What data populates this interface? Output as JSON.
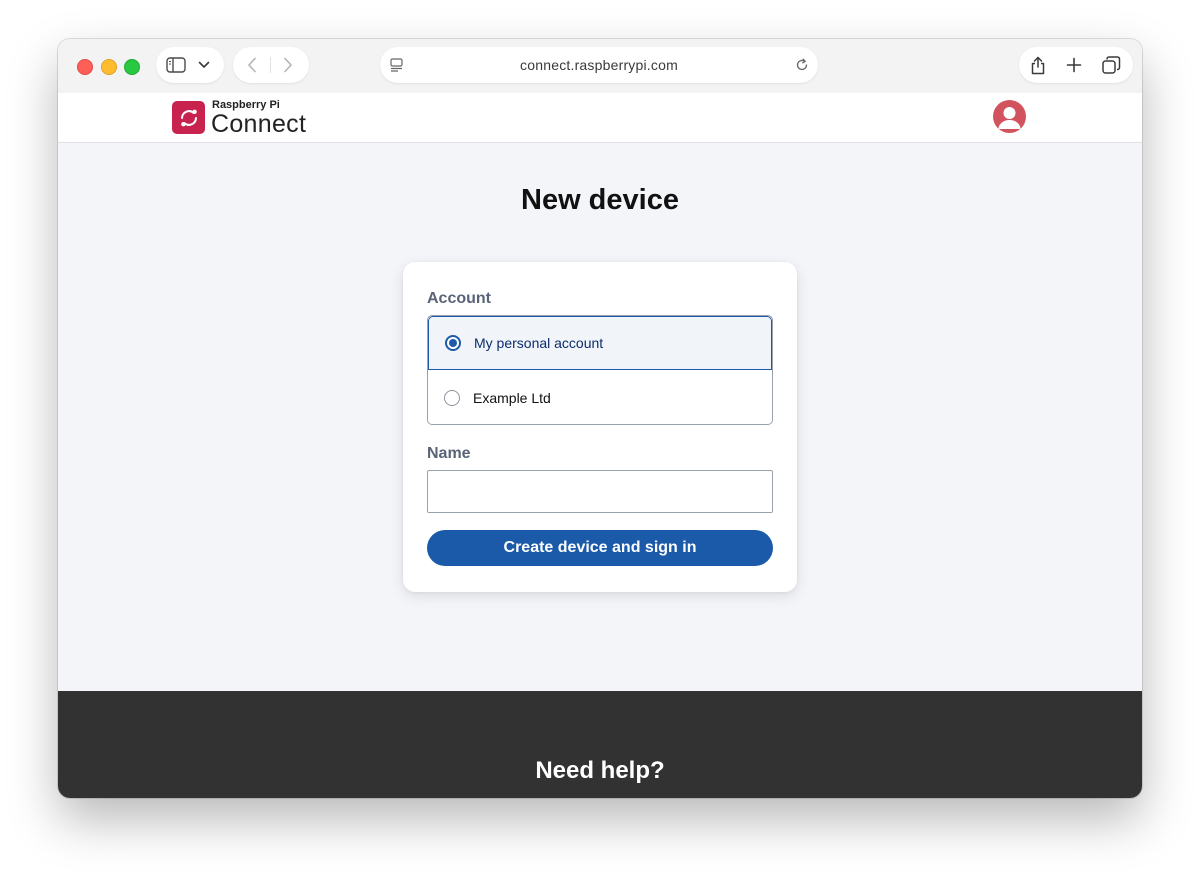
{
  "browser": {
    "url": "connect.raspberrypi.com",
    "traffic_lights": {
      "red": "#fe5f57",
      "yellow": "#febc2e",
      "green": "#28c840"
    },
    "icons": [
      "sidebar-toggle-icon",
      "chevron-down-icon",
      "back-icon",
      "forward-icon",
      "page-settings-icon",
      "reload-icon",
      "share-icon",
      "new-tab-icon",
      "tab-overview-icon"
    ]
  },
  "header": {
    "logo_small": "Raspberry Pi",
    "logo_big": "Connect",
    "logo_color": "#c8234f",
    "avatar_color": "#d2525d"
  },
  "main": {
    "title": "New device",
    "account": {
      "label": "Account",
      "options": [
        {
          "label": "My personal account",
          "selected": true
        },
        {
          "label": "Example Ltd",
          "selected": false
        }
      ]
    },
    "name": {
      "label": "Name",
      "value": "",
      "placeholder": ""
    },
    "submit_label": "Create device and sign in",
    "accent_color": "#1a5aa9"
  },
  "footer": {
    "title": "Need help?",
    "background": "#323232"
  }
}
